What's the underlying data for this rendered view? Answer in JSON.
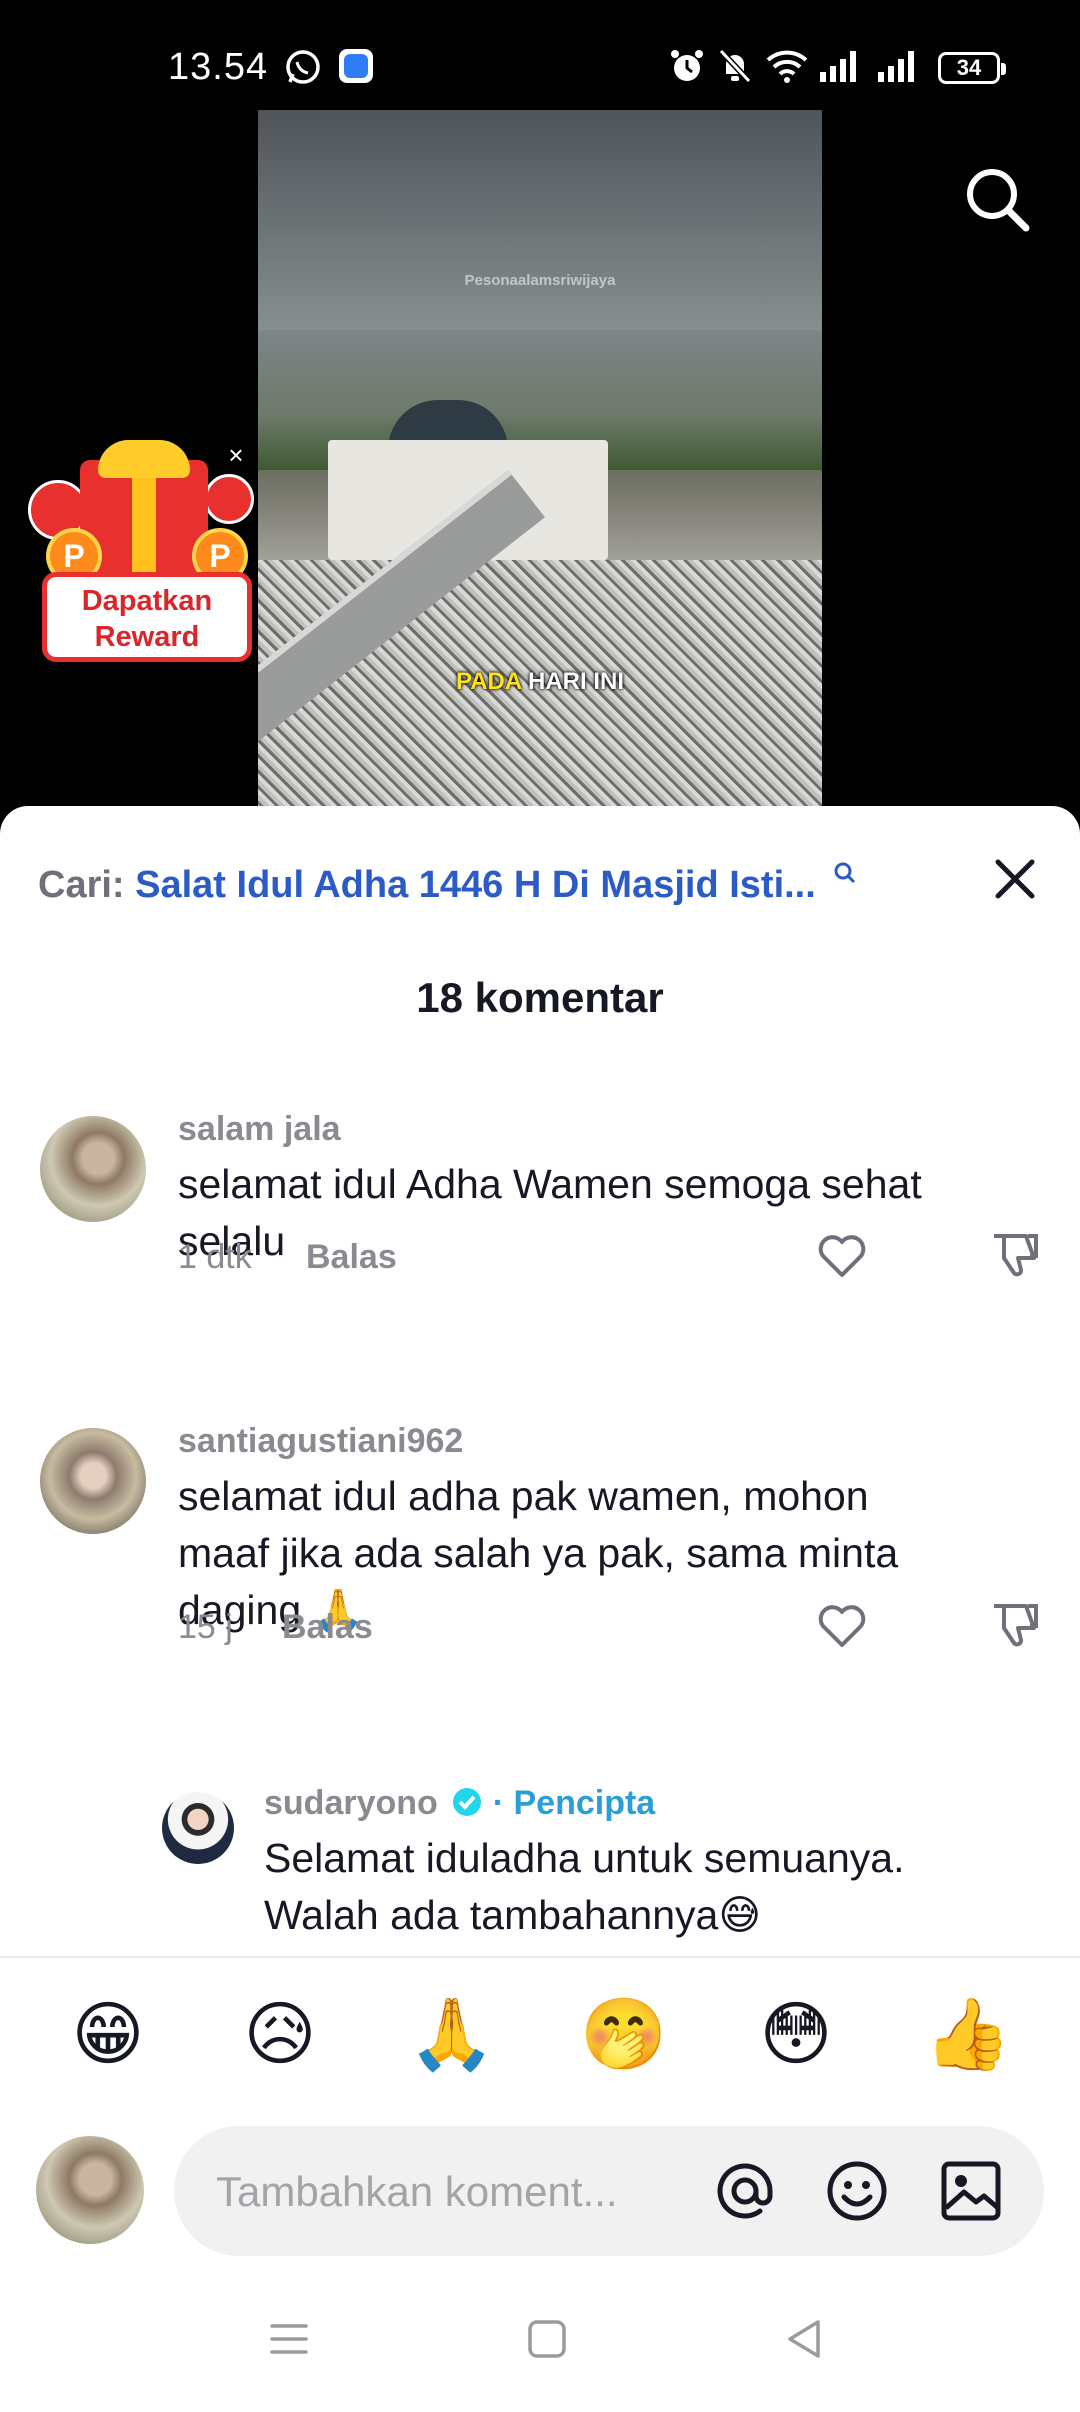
{
  "status_bar": {
    "time": "13.54",
    "battery": "34"
  },
  "video": {
    "watermark": "Pesonaalamsriwijaya",
    "caption_highlight": "PADA",
    "caption_rest": " HARI INI"
  },
  "reward": {
    "label_line1": "Dapatkan",
    "label_line2": "Reward",
    "coin_letter": "P",
    "close_glyph": "×"
  },
  "search": {
    "prefix": "Cari:",
    "query": "Salat Idul Adha 1446 H Di Masjid Isti..."
  },
  "comments_header": {
    "count_label": "18 komentar"
  },
  "comments": [
    {
      "username": "salam jala",
      "text_line1": "selamat idul Adha Wamen semoga sehat",
      "text_line2": "selalu",
      "time": "1 dtk",
      "reply_label": "Balas"
    },
    {
      "username": "santiagustiani962",
      "text_line1": "selamat idul adha pak wamen, mohon",
      "text_line2": "maaf jika ada salah ya pak, sama minta",
      "text_line3": "daging 🙏",
      "time": "15 j",
      "reply_label": "Balas"
    }
  ],
  "creator_reply": {
    "username": "sudaryono",
    "separator": "·",
    "creator_label": "Pencipta",
    "text_line1": "Selamat iduladha untuk semuanya.",
    "text_line2": "Walah ada tambahannya😅"
  },
  "emoji_bar": [
    "😁",
    "😥",
    "🙏",
    "🤭",
    "😳",
    "👍"
  ],
  "input": {
    "placeholder": "Tambahkan koment..."
  },
  "colors": {
    "link_blue": "#2b5bc6",
    "creator_blue": "#2a9fd6",
    "reward_red": "#e8302e"
  },
  "icons": [
    "whatsapp-icon",
    "app-icon",
    "alarm-icon",
    "mute-icon",
    "wifi-icon",
    "signal-icon",
    "battery-icon",
    "search-icon",
    "close-icon",
    "heart-icon",
    "dislike-icon",
    "verified-icon",
    "mention-icon",
    "emoji-icon",
    "image-icon",
    "menu-icon",
    "home-icon",
    "back-icon"
  ]
}
